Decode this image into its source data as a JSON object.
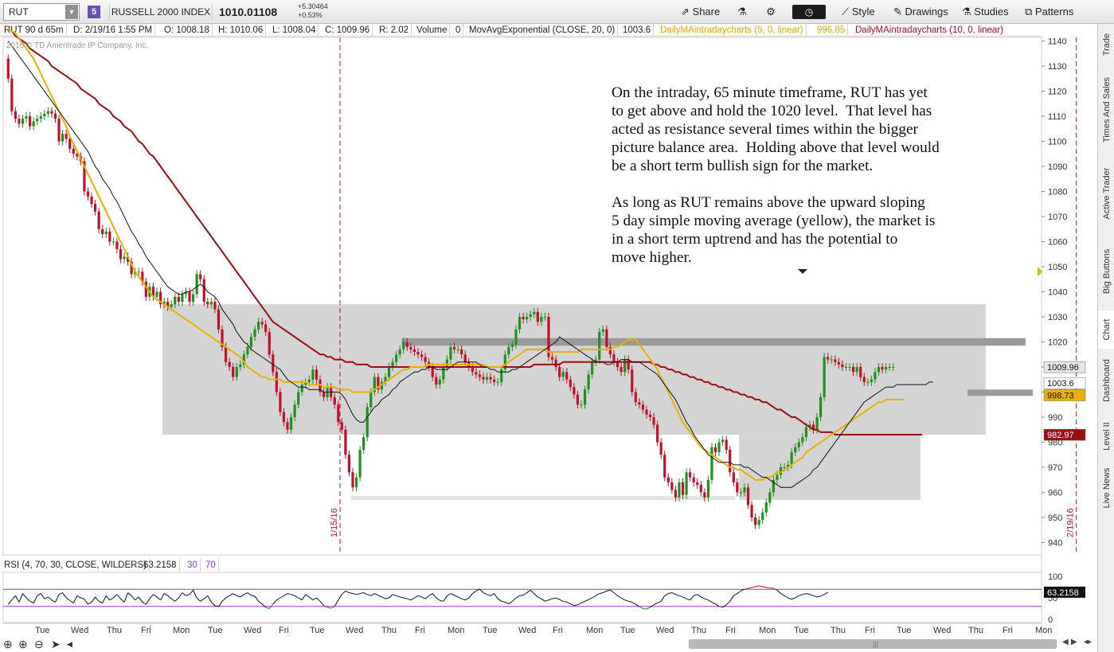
{
  "header": {
    "symbol": "RUT",
    "link_badge": "5",
    "index_name": "RUSSELL 2000 INDEX",
    "last": "1010.01108",
    "change_abs": "+5.30464",
    "change_pct": "+0.53%",
    "share": "Share",
    "style": "Style",
    "drawings": "Drawings",
    "studies": "Studies",
    "patterns": "Patterns"
  },
  "study_row": {
    "period": "RUT 90 d 65m",
    "date": "D: 2/19/16 1:55 PM",
    "open": "O: 1008.18",
    "high": "H: 1010.06",
    "low": "L: 1008.04",
    "close": "C: 1009.96",
    "range": "R: 2.02",
    "volume_label": "Volume",
    "volume_value": "0",
    "ema_label": "MovAvgExponential (CLOSE, 20, 0)",
    "ema_value": "1003.6",
    "sma5_label": "DailyMAintradaycharts (5, 0, linear)",
    "sma5_value": "996.85",
    "sma10_label": "DailyMAintradaycharts (10, 0, linear)"
  },
  "copyright": "2016 © TD Ameritrade IP Company, Inc.",
  "annotation": {
    "p1": "On the intraday, 65 minute timeframe, RUT has yet\nto get above and hold the 1020 level.  That level has\nacted as resistance several times within the bigger\npicture balance area.  Holding above that level would\nbe a short term bullish sign for the market.",
    "p2": "As long as RUT remains above the upward sloping\n5 day simple moving average (yellow), the market is\nin a short term uptrend and has the potential to\nmove higher."
  },
  "rsi_row": {
    "label": "RSI (4, 70, 30, CLOSE, WILDERS)",
    "value": "63.2158",
    "low": "30",
    "high": "70"
  },
  "right_tabs": [
    "Trade",
    "Times And Sales",
    "Active Trader",
    "Big Buttons",
    "Chart",
    "Dashboard",
    "Level II",
    "Live News"
  ],
  "colors": {
    "bull": "#1f8f1f",
    "bear": "#c0102a",
    "ema": "#111111",
    "sma5": "#e8b000",
    "sma10": "#9b0e12",
    "box": "#d4d4d4",
    "resistance": "#9a9a9a",
    "rsi": "#111111",
    "vline": "#c0102a"
  },
  "chart_data": {
    "type": "line",
    "chart_kind": "candlestick",
    "price_axis": {
      "ylim": [
        937,
        1145
      ],
      "ticks": [
        940,
        950,
        960,
        970,
        980,
        990,
        1000,
        1010,
        1020,
        1030,
        1040,
        1050,
        1060,
        1070,
        1080,
        1090,
        1100,
        1110,
        1120,
        1130,
        1140
      ]
    },
    "x_ticks": [
      "Tue",
      "Wed",
      "Thu",
      "Fri",
      "Mon",
      "Tue",
      "Wed",
      "Fri",
      "Tue",
      "Wed",
      "Thu",
      "Fri",
      "Mon",
      "Tue",
      "Wed",
      "Fri",
      "Mon",
      "Tue",
      "Wed",
      "Thu",
      "Fri",
      "Mon",
      "Tue",
      "Thu",
      "Fri",
      "Tue",
      "Wed",
      "Thu",
      "Fri",
      "Mon"
    ],
    "bars_per_day": 7,
    "vertical_markers": [
      {
        "label": "1/15/16",
        "bar": 92
      },
      {
        "label": "2/19/16",
        "bar": 295
      }
    ],
    "closes": [
      1125,
      1112,
      1109,
      1107,
      1109,
      1110,
      1106,
      1108,
      1109,
      1110,
      1111,
      1112,
      1111,
      1109,
      1100,
      1103,
      1101,
      1097,
      1095,
      1094,
      1092,
      1080,
      1078,
      1075,
      1072,
      1065,
      1063,
      1064,
      1060,
      1060,
      1057,
      1053,
      1054,
      1052,
      1047,
      1048,
      1048,
      1044,
      1038,
      1042,
      1038,
      1040,
      1035,
      1036,
      1034,
      1035,
      1038,
      1036,
      1039,
      1040,
      1036,
      1039,
      1047,
      1045,
      1036,
      1035,
      1036,
      1033,
      1025,
      1018,
      1012,
      1010,
      1006,
      1010,
      1011,
      1015,
      1018,
      1022,
      1025,
      1028,
      1027,
      1024,
      1015,
      1008,
      1000,
      992,
      988,
      985,
      990,
      995,
      1000,
      1003,
      1004,
      1005,
      1009,
      1005,
      1000,
      998,
      1002,
      998,
      995,
      988,
      985,
      975,
      968,
      962,
      966,
      977,
      982,
      994,
      1000,
      1006,
      1001,
      1004,
      1006,
      1010,
      1012,
      1015,
      1017,
      1020,
      1018,
      1017,
      1016,
      1015,
      1014,
      1012,
      1010,
      1006,
      1003,
      1005,
      1010,
      1013,
      1018,
      1017,
      1017,
      1015,
      1012,
      1010,
      1008,
      1007,
      1006,
      1005,
      1006,
      1005,
      1004,
      1004,
      1009,
      1015,
      1018,
      1019,
      1025,
      1030,
      1029,
      1030,
      1031,
      1032,
      1028,
      1030,
      1030,
      1014,
      1013,
      1010,
      1006,
      1008,
      1005,
      1002,
      999,
      995,
      995,
      1001,
      1007,
      1012,
      1013,
      1024,
      1025,
      1018,
      1015,
      1012,
      1010,
      1008,
      1013,
      1009,
      1000,
      996,
      995,
      993,
      991,
      990,
      987,
      980,
      975,
      966,
      964,
      961,
      958,
      964,
      959,
      968,
      966,
      964,
      963,
      960,
      958,
      965,
      978,
      976,
      980,
      981,
      977,
      968,
      964,
      960,
      960,
      962,
      955,
      950,
      947,
      949,
      952,
      956,
      960,
      965,
      967,
      970,
      970,
      971,
      976,
      978,
      980,
      982,
      986,
      987,
      985,
      990,
      998,
      1014,
      1013,
      1013,
      1012,
      1011,
      1010,
      1010,
      1010,
      1008,
      1010,
      1006,
      1004,
      1004,
      1005,
      1008,
      1010,
      1009,
      1010,
      1010,
      1010
    ],
    "ema20": [
      1140,
      1138,
      1136,
      1134,
      1132,
      1130,
      1128,
      1126,
      1124,
      1122,
      1120,
      1118,
      1116,
      1114,
      1112,
      1110,
      1108,
      1106,
      1104,
      1102,
      1100,
      1098,
      1096,
      1093,
      1090,
      1088,
      1085,
      1083,
      1081,
      1078,
      1076,
      1073,
      1070,
      1067,
      1064,
      1062,
      1059,
      1057,
      1054,
      1052,
      1050,
      1048,
      1046,
      1044,
      1042,
      1041,
      1040,
      1039,
      1039,
      1040,
      1040,
      1041,
      1042,
      1043,
      1042,
      1040,
      1039,
      1038,
      1036,
      1033,
      1031,
      1029,
      1027,
      1024,
      1022,
      1020,
      1019,
      1017,
      1016,
      1015,
      1014,
      1013,
      1012,
      1011,
      1010,
      1009,
      1007,
      1005,
      1004,
      1003,
      1002,
      1002,
      1002,
      1001,
      1001,
      1001,
      1001,
      1000,
      1000,
      1000,
      1000,
      1000,
      999,
      997,
      994,
      991,
      989,
      988,
      988,
      990,
      992,
      994,
      995,
      997,
      998,
      999,
      1001,
      1002,
      1004,
      1005,
      1006,
      1007,
      1008,
      1008,
      1009,
      1009,
      1010,
      1010,
      1009,
      1009,
      1009,
      1009,
      1010,
      1011,
      1012,
      1012,
      1012,
      1012,
      1012,
      1012,
      1011,
      1010,
      1010,
      1009,
      1009,
      1008,
      1008,
      1008,
      1008,
      1009,
      1009,
      1010,
      1011,
      1012,
      1013,
      1014,
      1015,
      1016,
      1017,
      1018,
      1019,
      1020,
      1022,
      1021,
      1020,
      1019,
      1018,
      1017,
      1016,
      1015,
      1014,
      1013,
      1012,
      1012,
      1012,
      1011,
      1011,
      1012,
      1012,
      1013,
      1013,
      1013,
      1012,
      1012,
      1012,
      1011,
      1010,
      1009,
      1008,
      1007,
      1005,
      1003,
      1001,
      999,
      997,
      994,
      991,
      988,
      986,
      983,
      981,
      979,
      977,
      975,
      974,
      973,
      972,
      972,
      972,
      972,
      971,
      971,
      971,
      970,
      970,
      969,
      968,
      967,
      966,
      966,
      965,
      964,
      963,
      962,
      962,
      962,
      962,
      963,
      964,
      965,
      966,
      967,
      969,
      970,
      972,
      974,
      976,
      978,
      980,
      982,
      984,
      986,
      988,
      990,
      992,
      994,
      996,
      997,
      998,
      999,
      1000,
      1001,
      1002,
      1002,
      1002,
      1003,
      1003,
      1003,
      1003,
      1003,
      1003,
      1003,
      1003,
      1003,
      1004,
      1004
    ],
    "sma5": [
      1145,
      1144,
      1143,
      1141,
      1139,
      1137,
      1135,
      1133,
      1130,
      1127,
      1124,
      1121,
      1118,
      1115,
      1112,
      1109,
      1106,
      1102,
      1099,
      1096,
      1093,
      1090,
      1087,
      1084,
      1081,
      1078,
      1075,
      1072,
      1069,
      1066,
      1063,
      1060,
      1057,
      1054,
      1051,
      1048,
      1046,
      1044,
      1042,
      1040,
      1038,
      1037,
      1036,
      1035,
      1034,
      1033,
      1032,
      1031,
      1030,
      1029,
      1028,
      1027,
      1026,
      1025,
      1024,
      1023,
      1022,
      1021,
      1020,
      1019,
      1018,
      1017,
      1016,
      1015,
      1014,
      1012,
      1010,
      1009,
      1008,
      1007,
      1006,
      1006,
      1005,
      1005,
      1005,
      1005,
      1004,
      1004,
      1004,
      1004,
      1004,
      1004,
      1004,
      1003,
      1003,
      1003,
      1003,
      1002,
      1002,
      1002,
      1002,
      1001,
      1001,
      1001,
      1001,
      1000,
      1000,
      1000,
      1000,
      1000,
      1000,
      1001,
      1002,
      1003,
      1004,
      1005,
      1006,
      1007,
      1008,
      1009,
      1009,
      1010,
      1010,
      1010,
      1010,
      1010,
      1011,
      1011,
      1011,
      1011,
      1011,
      1011,
      1011,
      1011,
      1011,
      1011,
      1011,
      1011,
      1011,
      1011,
      1011,
      1011,
      1010,
      1010,
      1010,
      1010,
      1010,
      1011,
      1012,
      1013,
      1014,
      1015,
      1016,
      1017,
      1017,
      1017,
      1017,
      1017,
      1017,
      1016,
      1016,
      1016,
      1016,
      1016,
      1016,
      1016,
      1016,
      1016,
      1017,
      1017,
      1017,
      1017,
      1017,
      1017,
      1017,
      1017,
      1017,
      1018,
      1018,
      1019,
      1020,
      1021,
      1021,
      1021,
      1019,
      1017,
      1015,
      1013,
      1011,
      1009,
      1006,
      1003,
      1000,
      997,
      994,
      991,
      988,
      986,
      984,
      982,
      980,
      978,
      977,
      976,
      975,
      974,
      973,
      972,
      971,
      970,
      970,
      969,
      969,
      968,
      967,
      966,
      965,
      965,
      965,
      966,
      966,
      967,
      968,
      968,
      969,
      970,
      971,
      972,
      973,
      974,
      976,
      977,
      978,
      979,
      980,
      981,
      982,
      983,
      984,
      985,
      986,
      987,
      988,
      989,
      990,
      991,
      992,
      993,
      994,
      995,
      996,
      996,
      997,
      997,
      997,
      997,
      997,
      997
    ],
    "sma10": [
      1145,
      1144,
      1142,
      1141,
      1140,
      1139,
      1137,
      1136,
      1135,
      1134,
      1133,
      1132,
      1130,
      1129,
      1128,
      1127,
      1126,
      1125,
      1124,
      1123,
      1121,
      1120,
      1119,
      1118,
      1117,
      1115,
      1114,
      1113,
      1112,
      1110,
      1109,
      1108,
      1106,
      1105,
      1104,
      1102,
      1100,
      1099,
      1097,
      1095,
      1094,
      1092,
      1090,
      1088,
      1086,
      1084,
      1082,
      1080,
      1078,
      1076,
      1074,
      1072,
      1070,
      1068,
      1066,
      1064,
      1062,
      1060,
      1058,
      1056,
      1054,
      1052,
      1050,
      1048,
      1046,
      1044,
      1042,
      1040,
      1038,
      1036,
      1034,
      1032,
      1030,
      1028,
      1027,
      1026,
      1025,
      1024,
      1023,
      1022,
      1021,
      1020,
      1019,
      1018,
      1017,
      1016,
      1015,
      1015,
      1014,
      1014,
      1013,
      1013,
      1013,
      1012,
      1012,
      1012,
      1011,
      1011,
      1011,
      1011,
      1010,
      1010,
      1010,
      1010,
      1010,
      1010,
      1010,
      1010,
      1010,
      1010,
      1010,
      1010,
      1010,
      1010,
      1010,
      1010,
      1010,
      1010,
      1010,
      1010,
      1010,
      1010,
      1010,
      1010,
      1010,
      1010,
      1010,
      1010,
      1010,
      1010,
      1010,
      1010,
      1010,
      1010,
      1010,
      1010,
      1010,
      1010,
      1010,
      1010,
      1010,
      1010,
      1010,
      1010,
      1010,
      1011,
      1011,
      1011,
      1011,
      1011,
      1011,
      1011,
      1011,
      1012,
      1012,
      1012,
      1012,
      1012,
      1012,
      1012,
      1012,
      1012,
      1012,
      1012,
      1012,
      1012,
      1012,
      1012,
      1012,
      1012,
      1012,
      1012,
      1012,
      1012,
      1012,
      1012,
      1012,
      1012,
      1011,
      1011,
      1010,
      1010,
      1009,
      1009,
      1008,
      1008,
      1007,
      1007,
      1006,
      1006,
      1005,
      1005,
      1004,
      1004,
      1003,
      1003,
      1002,
      1002,
      1001,
      1001,
      1000,
      1000,
      999,
      999,
      998,
      998,
      997,
      997,
      996,
      996,
      995,
      994,
      993,
      993,
      992,
      991,
      990,
      990,
      989,
      988,
      987,
      986,
      985,
      985,
      984,
      984,
      984,
      984,
      983,
      983,
      983,
      983,
      983,
      983,
      983,
      983,
      983,
      983,
      983,
      983,
      983,
      983,
      983,
      983,
      983,
      983,
      983,
      983,
      983,
      983,
      983,
      983,
      983
    ],
    "rsi": [
      35,
      45,
      55,
      40,
      60,
      50,
      42,
      38,
      55,
      60,
      48,
      52,
      45,
      40,
      58,
      62,
      50,
      44,
      38,
      55,
      50,
      47,
      35,
      40,
      52,
      42,
      38,
      55,
      45,
      50,
      58,
      48,
      40,
      62,
      55,
      45,
      52,
      40,
      35,
      48,
      58,
      52,
      45,
      60,
      55,
      48,
      42,
      50,
      62,
      55,
      58,
      68,
      50,
      42,
      48,
      55,
      40,
      32,
      30,
      42,
      50,
      55,
      60,
      55,
      52,
      58,
      62,
      56,
      54,
      42,
      36,
      28,
      25,
      35,
      45,
      50,
      55,
      60,
      58,
      55,
      50,
      45,
      58,
      52,
      45,
      50,
      42,
      32,
      28,
      26,
      30,
      45,
      58,
      66,
      62,
      60,
      58,
      60,
      62,
      58,
      55,
      60,
      56,
      52,
      48,
      50,
      58,
      55,
      52,
      50,
      48,
      45,
      50,
      55,
      52,
      48,
      55,
      60,
      50,
      44,
      42,
      55,
      60,
      56,
      52,
      48,
      45,
      50,
      60,
      66,
      70,
      62,
      58,
      55,
      60,
      48,
      42,
      40,
      36,
      42,
      50,
      55,
      56,
      62,
      68,
      60,
      52,
      48,
      42,
      45,
      48,
      50,
      46,
      42,
      40,
      36,
      32,
      34,
      38,
      42,
      46,
      50,
      55,
      60,
      62,
      66,
      68,
      62,
      55,
      50,
      45,
      42,
      40,
      35,
      30,
      25,
      24,
      28,
      34,
      38,
      42,
      55,
      60,
      62,
      58,
      55,
      52,
      48,
      45,
      55,
      58,
      52,
      48,
      45,
      40,
      36,
      30,
      28,
      34,
      42,
      55,
      60,
      66,
      70,
      72,
      74,
      76,
      78,
      76,
      74,
      73,
      72,
      68,
      60,
      55,
      50,
      47,
      50,
      55,
      58,
      60,
      58,
      55,
      52,
      54,
      58,
      63
    ],
    "rsi_axis": {
      "ylim": [
        0,
        100
      ],
      "ticks": [
        0,
        50,
        100
      ],
      "overbought": 70,
      "oversold": 30
    }
  }
}
